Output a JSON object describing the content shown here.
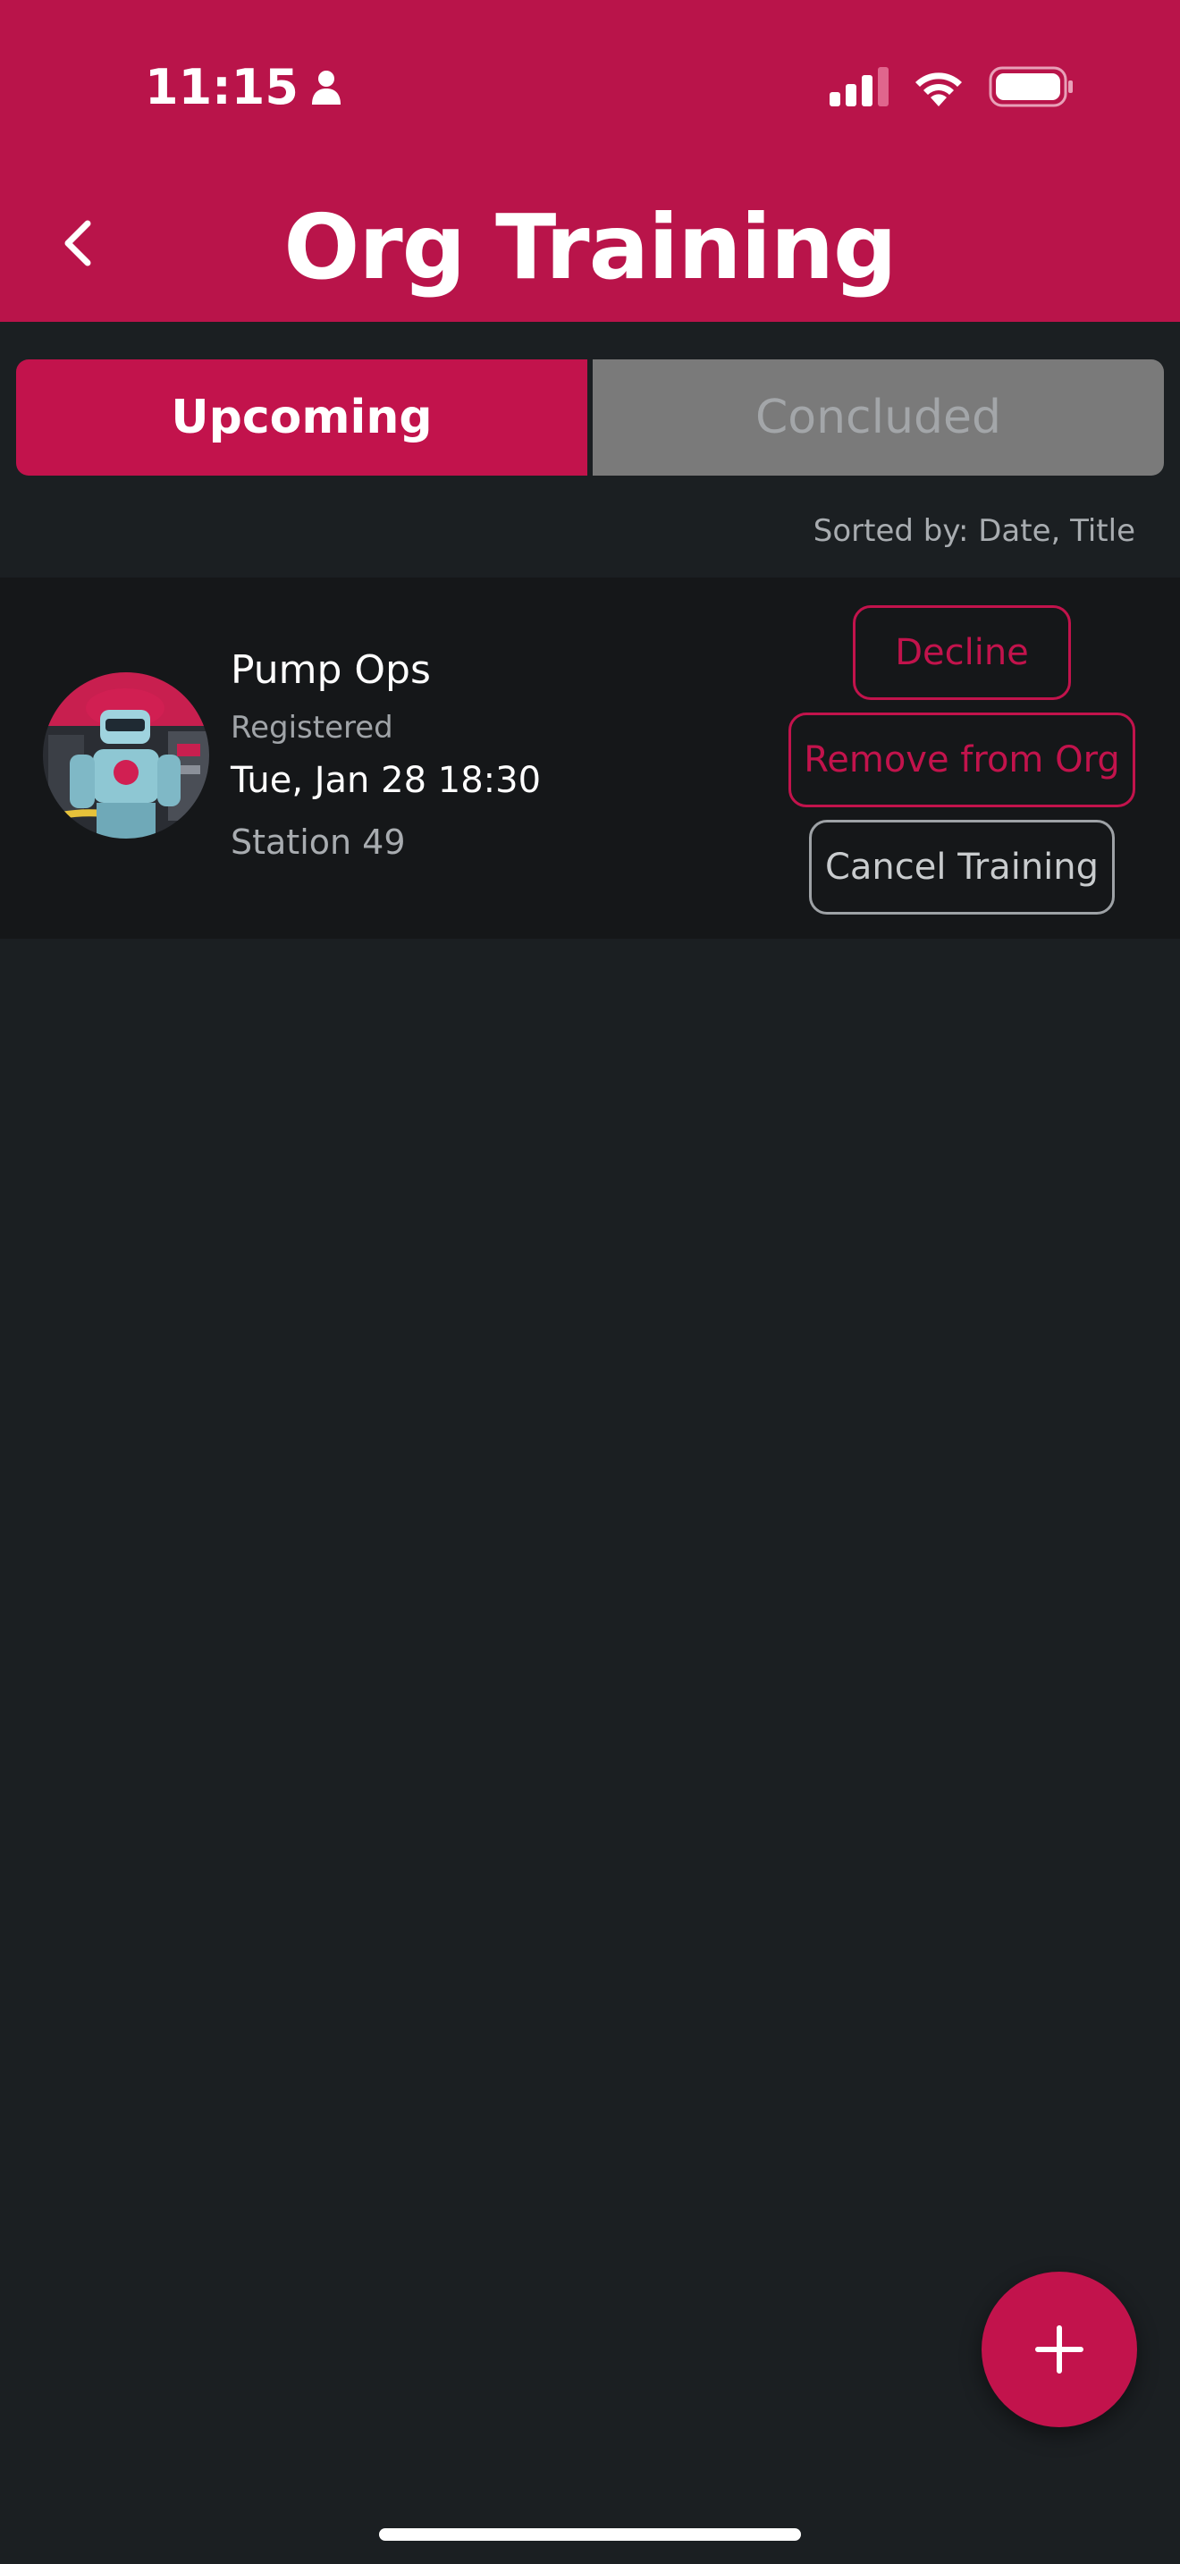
{
  "status_bar": {
    "time": "11:15",
    "icons": [
      "person-icon",
      "signal-icon",
      "wifi-icon",
      "battery-icon"
    ]
  },
  "header": {
    "title": "Org Training",
    "back_icon": "chevron-left-icon"
  },
  "tabs": [
    {
      "label": "Upcoming",
      "active": true
    },
    {
      "label": "Concluded",
      "active": false
    }
  ],
  "sort": {
    "label": "Sorted by: Date, Title"
  },
  "trainings": [
    {
      "title": "Pump Ops",
      "status": "Registered",
      "date": "Tue, Jan 28 18:30",
      "location": "Station 49",
      "actions": {
        "decline": "Decline",
        "remove": "Remove from Org",
        "cancel": "Cancel Training"
      }
    }
  ],
  "fab": {
    "icon": "plus-icon"
  },
  "colors": {
    "brand": "#b9144a",
    "accent": "#c2134c",
    "background": "#1b1f22",
    "card": "#151719"
  }
}
